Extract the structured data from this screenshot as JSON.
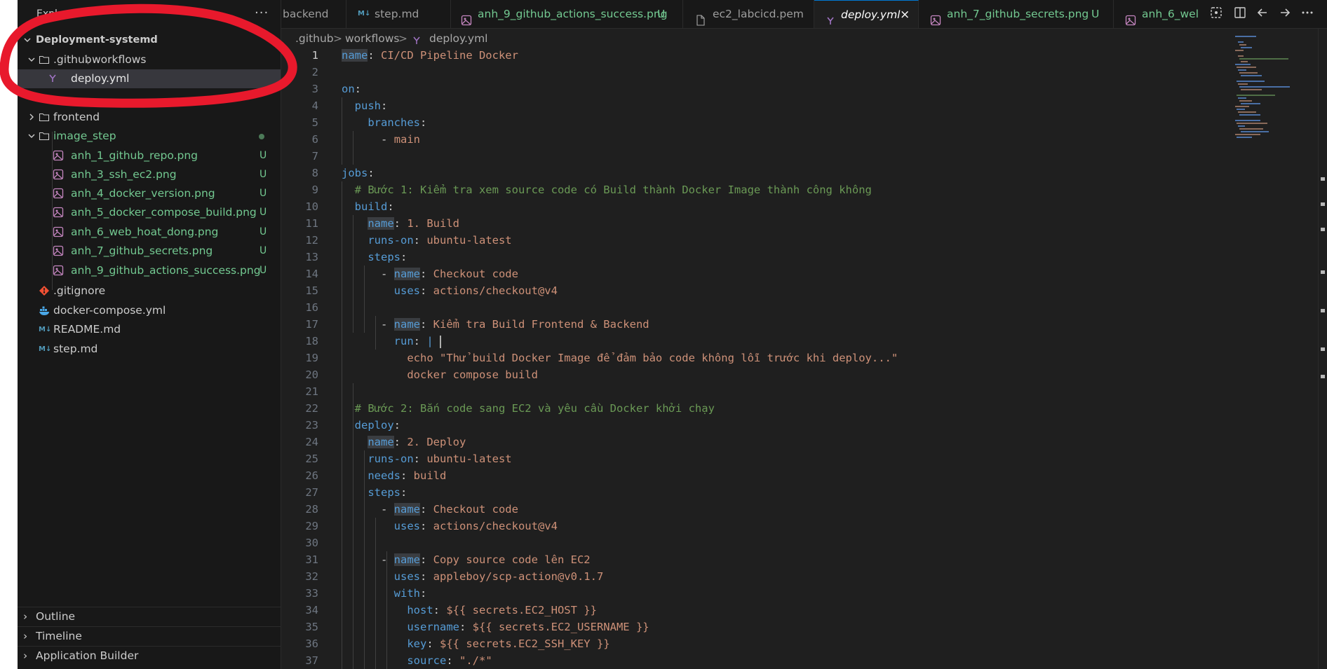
{
  "explorer": {
    "title": "Explorer",
    "more": "···",
    "root": "Deployment-systemd",
    "github_folder": ".github",
    "github_sep": "\\",
    "workflows_folder": "workflows",
    "deploy_file": "deploy.yml",
    "frontend": "frontend",
    "image_step": "image_step",
    "images": [
      {
        "name": "anh_1_github_repo.png",
        "status": "U"
      },
      {
        "name": "anh_3_ssh_ec2.png",
        "status": "U"
      },
      {
        "name": "anh_4_docker_version.png",
        "status": "U"
      },
      {
        "name": "anh_5_docker_compose_build.png",
        "status": "U"
      },
      {
        "name": "anh_6_web_hoat_dong.png",
        "status": "U"
      },
      {
        "name": "anh_7_github_secrets.png",
        "status": "U"
      },
      {
        "name": "anh_9_github_actions_success.png",
        "status": "U"
      }
    ],
    "files": [
      ".gitignore",
      "docker-compose.yml",
      "README.md",
      "step.md"
    ],
    "outline": "Outline",
    "timeline": "Timeline",
    "app_builder": "Application Builder"
  },
  "tabs": [
    {
      "label": "backend",
      "status": ""
    },
    {
      "label": "step.md",
      "status": ""
    },
    {
      "label": "anh_9_github_actions_success.png",
      "status": "U"
    },
    {
      "label": "ec2_labcicd.pem",
      "status": ""
    },
    {
      "label": "deploy.yml",
      "status": "×"
    },
    {
      "label": "anh_7_github_secrets.png",
      "status": "U"
    },
    {
      "label": "anh_6_wel",
      "status": ""
    }
  ],
  "breadcrumb": {
    "part1": ".github",
    "part2": "workflows",
    "file": "deploy.yml",
    "sep": ">"
  },
  "code": {
    "line_numbers": [
      "1",
      "2",
      "3",
      "4",
      "5",
      "6",
      "7",
      "8",
      "9",
      "10",
      "11",
      "12",
      "13",
      "14",
      "15",
      "16",
      "17",
      "18",
      "19",
      "20",
      "21",
      "22",
      "23",
      "24",
      "25",
      "26",
      "27",
      "28",
      "29",
      "30",
      "31",
      "32",
      "33",
      "34",
      "35",
      "36",
      "37"
    ],
    "l1": {
      "key": "name",
      "val": "CI/CD Pipeline Docker"
    },
    "l3": {
      "key": "on"
    },
    "l4": {
      "key": "push"
    },
    "l5": {
      "key": "branches"
    },
    "l6": {
      "dash": "-",
      "val": "main"
    },
    "l8": {
      "key": "jobs"
    },
    "l9": {
      "comment": "# Bước 1: Kiểm tra xem source code có Build thành Docker Image thành công không"
    },
    "l10": {
      "key": "build"
    },
    "l11": {
      "key": "name",
      "val": "1. Build"
    },
    "l12": {
      "key": "runs-on",
      "val": "ubuntu-latest"
    },
    "l13": {
      "key": "steps"
    },
    "l14": {
      "key": "name",
      "val": "Checkout code"
    },
    "l15": {
      "key": "uses",
      "val": "actions/checkout@v4"
    },
    "l17": {
      "key": "name",
      "val": "Kiểm tra Build Frontend & Backend"
    },
    "l18": {
      "key": "run",
      "val": "|"
    },
    "l19": {
      "val": "echo \"Thử build Docker Image để đảm bảo code không lỗi trước khi deploy...\""
    },
    "l20": {
      "val": "docker compose build"
    },
    "l22": {
      "comment": "# Bước 2: Bắn code sang EC2 và yêu cầu Docker khởi chạy"
    },
    "l23": {
      "key": "deploy"
    },
    "l24": {
      "key": "name",
      "val": "2. Deploy"
    },
    "l25": {
      "key": "runs-on",
      "val": "ubuntu-latest"
    },
    "l26": {
      "key": "needs",
      "val": "build"
    },
    "l27": {
      "key": "steps"
    },
    "l28": {
      "key": "name",
      "val": "Checkout code"
    },
    "l29": {
      "key": "uses",
      "val": "actions/checkout@v4"
    },
    "l31": {
      "key": "name",
      "val": "Copy source code lên EC2"
    },
    "l32": {
      "key": "uses",
      "val": "appleboy/scp-action@v0.1.7"
    },
    "l33": {
      "key": "with"
    },
    "l34": {
      "key": "host",
      "val": "${{ secrets.EC2_HOST }}"
    },
    "l35": {
      "key": "username",
      "val": "${{ secrets.EC2_USERNAME }}"
    },
    "l36": {
      "key": "key",
      "val": "${{ secrets.EC2_SSH_KEY }}"
    },
    "l37": {
      "key": "source",
      "val": "\"./*\""
    }
  },
  "colors": {
    "annotation": "#e8192c",
    "accent": "#0078d4",
    "untracked": "#73c991"
  }
}
